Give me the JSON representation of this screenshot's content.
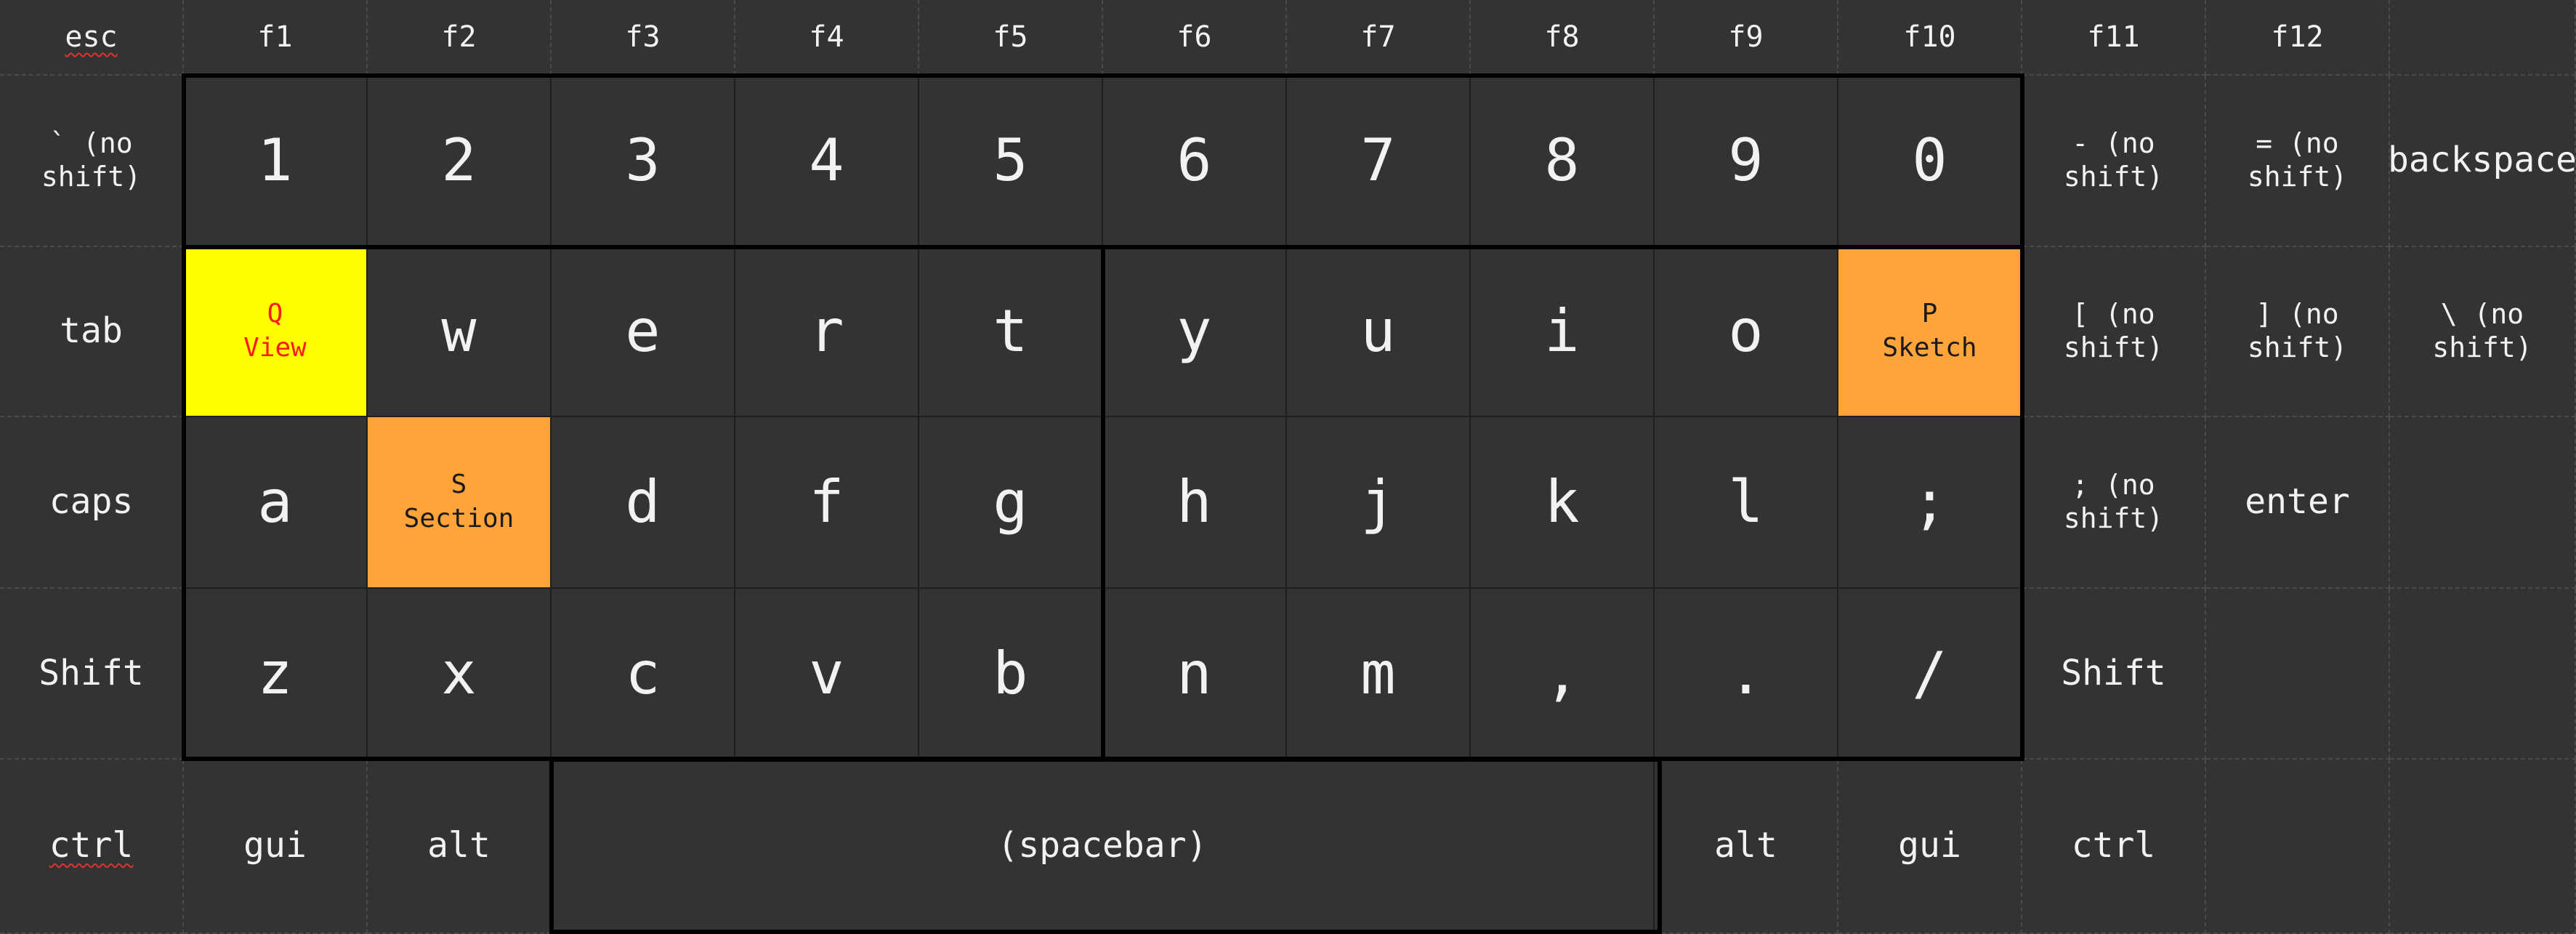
{
  "keyboard": {
    "row_fn": [
      "esc",
      "f1",
      "f2",
      "f3",
      "f4",
      "f5",
      "f6",
      "f7",
      "f8",
      "f9",
      "f10",
      "f11",
      "f12",
      ""
    ],
    "row_num": [
      "` (no\nshift)",
      "1",
      "2",
      "3",
      "4",
      "5",
      "6",
      "7",
      "8",
      "9",
      "0",
      "- (no\nshift)",
      "= (no\nshift)",
      "backspace"
    ],
    "row_top": [
      "tab",
      "Q\nView",
      "w",
      "e",
      "r",
      "t",
      "y",
      "u",
      "i",
      "o",
      "P\nSketch",
      "[ (no\nshift)",
      "] (no\nshift)",
      "\\ (no\nshift)"
    ],
    "row_home": [
      "caps",
      "a",
      "S\nSection",
      "d",
      "f",
      "g",
      "h",
      "j",
      "k",
      "l",
      ";",
      "; (no\nshift)",
      "enter",
      ""
    ],
    "row_bottom": [
      "Shift",
      "z",
      "x",
      "c",
      "v",
      "b",
      "n",
      "m",
      ",",
      ".",
      "/",
      "Shift",
      "",
      ""
    ],
    "row_mod": {
      "ctrl_left": "ctrl",
      "gui_left": "gui",
      "alt_left": "alt",
      "spacebar": "(spacebar)",
      "alt_right": "alt",
      "gui_right": "gui",
      "ctrl_right": "ctrl"
    }
  },
  "colors": {
    "background": "#333333",
    "highlight_view": "#ffff00",
    "highlight_view_text": "#ff1a1a",
    "highlight_other": "#ffa43a",
    "text": "#f2f2f2"
  }
}
